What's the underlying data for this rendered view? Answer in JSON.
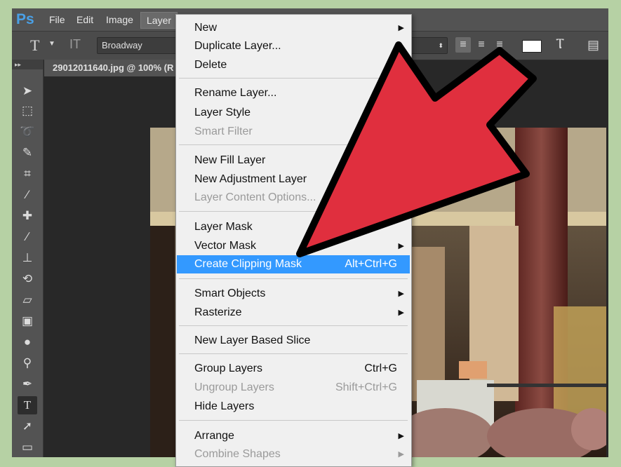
{
  "app": {
    "logo": "Ps",
    "menus": [
      "File",
      "Edit",
      "Image",
      "Layer"
    ]
  },
  "options": {
    "font": "Broadway",
    "size": "p"
  },
  "document": {
    "tab_title": "29012011640.jpg @ 100% (R"
  },
  "layer_menu": {
    "items": [
      {
        "label": "New",
        "submenu": true
      },
      {
        "label": "Duplicate Layer..."
      },
      {
        "label": "Delete"
      },
      {
        "label": "Rename Layer..."
      },
      {
        "label": "Layer Style"
      },
      {
        "label": "Smart Filter",
        "disabled": true
      },
      {
        "label": "New Fill Layer"
      },
      {
        "label": "New Adjustment Layer"
      },
      {
        "label": "Layer Content Options...",
        "disabled": true
      },
      {
        "label": "Layer Mask"
      },
      {
        "label": "Vector Mask",
        "submenu": true
      },
      {
        "label": "Create Clipping Mask",
        "shortcut": "Alt+Ctrl+G",
        "highlighted": true
      },
      {
        "label": "Smart Objects",
        "submenu": true
      },
      {
        "label": "Rasterize",
        "submenu": true
      },
      {
        "label": "New Layer Based Slice"
      },
      {
        "label": "Group Layers",
        "shortcut": "Ctrl+G"
      },
      {
        "label": "Ungroup Layers",
        "shortcut": "Shift+Ctrl+G",
        "disabled": true
      },
      {
        "label": "Hide Layers"
      },
      {
        "label": "Arrange",
        "submenu": true
      },
      {
        "label": "Combine Shapes",
        "disabled": true,
        "submenu": true
      }
    ]
  },
  "colors": {
    "highlight": "#3399ff",
    "arrow": "#e02f3e",
    "frame_bg": "#b6d1a4"
  }
}
